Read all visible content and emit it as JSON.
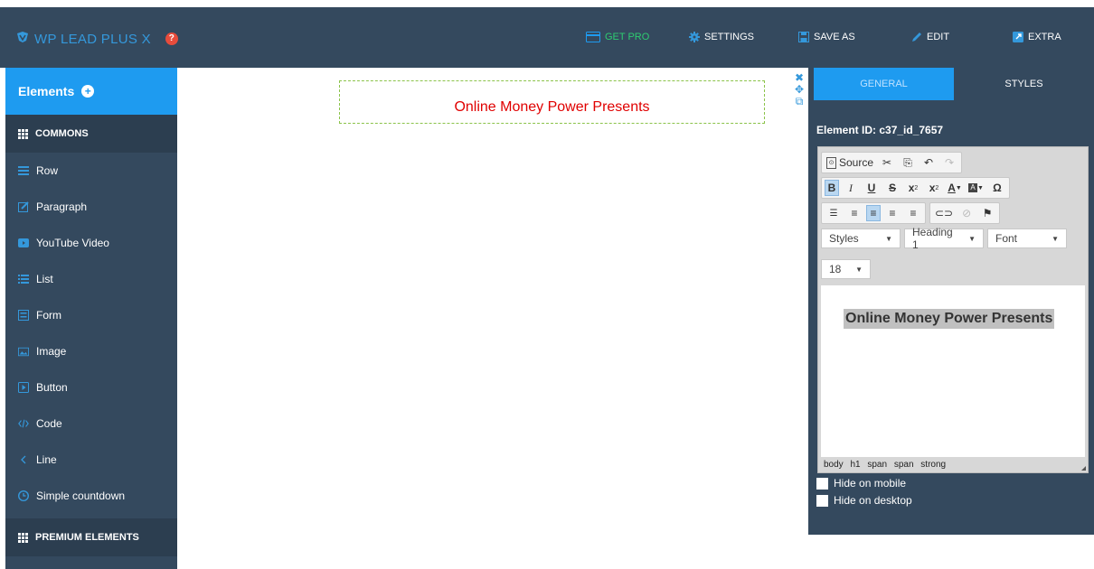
{
  "app": {
    "brand": "WP LEAD PLUS X"
  },
  "nav": {
    "get_pro": "GET PRO",
    "settings": "SETTINGS",
    "save_as": "SAVE AS",
    "edit": "EDIT",
    "extra": "EXTRA"
  },
  "sidebar": {
    "header": "Elements",
    "commons": "COMMONS",
    "items": [
      {
        "label": "Row",
        "icon": "row-icon"
      },
      {
        "label": "Paragraph",
        "icon": "paragraph-icon"
      },
      {
        "label": "YouTube Video",
        "icon": "youtube-icon"
      },
      {
        "label": "List",
        "icon": "list-icon"
      },
      {
        "label": "Form",
        "icon": "form-icon"
      },
      {
        "label": "Image",
        "icon": "image-icon"
      },
      {
        "label": "Button",
        "icon": "button-icon"
      },
      {
        "label": "Code",
        "icon": "code-icon"
      },
      {
        "label": "Line",
        "icon": "line-icon"
      },
      {
        "label": "Simple countdown",
        "icon": "clock-icon"
      }
    ],
    "premium": "PREMIUM ELEMENTS"
  },
  "canvas": {
    "heading": "Online Money Power Presents"
  },
  "panel": {
    "tabs": [
      "GENERAL",
      "STYLES"
    ],
    "element_id": "Element ID: c37_id_7657",
    "editor": {
      "source_label": "Source",
      "styles_combo": "Styles",
      "format_combo": "Heading 1",
      "font_combo": "Font",
      "size_combo": "18",
      "content": "Online Money Power Presents",
      "path": "body h1 span span strong"
    },
    "hide_mobile": "Hide on mobile",
    "hide_desktop": "Hide on desktop"
  },
  "colors": {
    "dark": "#34495e",
    "accent": "#1e9bf0",
    "heading_red": "#e00000",
    "get_pro": "#2ecc71"
  }
}
